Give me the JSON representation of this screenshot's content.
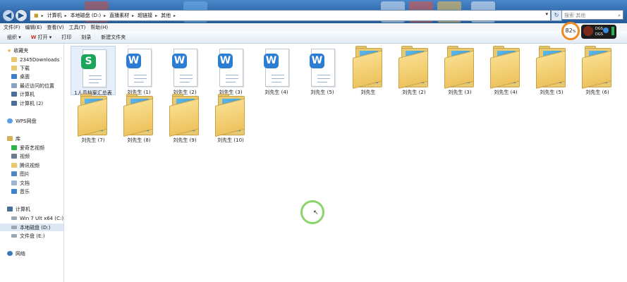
{
  "address": {
    "crumbs": [
      "计算机",
      "本地磁盘 (D:)",
      "直播素材",
      "超链接",
      "其他"
    ],
    "search_placeholder": "搜索 其他"
  },
  "menu": [
    "文件(F)",
    "编辑(E)",
    "查看(V)",
    "工具(T)",
    "帮助(H)"
  ],
  "toolbar": {
    "organize": "组织 ▾",
    "open": "打开 ▾",
    "print": "打印",
    "burn": "刻录",
    "new_folder": "新建文件夹"
  },
  "gauge": {
    "percent": "82",
    "unit": "%"
  },
  "widget": {
    "line1": "DGS",
    "line2": "DGS"
  },
  "nav": {
    "favorites": "收藏夹",
    "fav_items": [
      "2345Downloads",
      "下载",
      "桌面",
      "最近访问的位置",
      "计算机",
      "计算机 (2)"
    ],
    "wps": "WPS网盘",
    "library": "库",
    "lib_items": [
      "爱奇艺视频",
      "视频",
      "腾讯视频",
      "图片",
      "文档",
      "音乐"
    ],
    "computer": "计算机",
    "drives": [
      "Win 7 Ult x64 (C:)",
      "本地磁盘 (D:)",
      "文件盘 (E:)"
    ],
    "network": "网络"
  },
  "files": [
    {
      "name": "1人员档案汇总表",
      "type": "spreadsheet"
    },
    {
      "name": "刘先生 (1)",
      "type": "word"
    },
    {
      "name": "刘先生 (2)",
      "type": "word"
    },
    {
      "name": "刘先生 (3)",
      "type": "word"
    },
    {
      "name": "刘先生 (4)",
      "type": "word"
    },
    {
      "name": "刘先生 (5)",
      "type": "word"
    },
    {
      "name": "刘先生",
      "type": "folder"
    },
    {
      "name": "刘先生 (2)",
      "type": "folder"
    },
    {
      "name": "刘先生 (3)",
      "type": "folder"
    },
    {
      "name": "刘先生 (4)",
      "type": "folder"
    },
    {
      "name": "刘先生 (5)",
      "type": "folder"
    },
    {
      "name": "刘先生 (6)",
      "type": "folder"
    },
    {
      "name": "刘先生 (7)",
      "type": "folder"
    },
    {
      "name": "刘先生 (8)",
      "type": "folder"
    },
    {
      "name": "刘先生 (9)",
      "type": "folder"
    },
    {
      "name": "刘先生 (10)",
      "type": "folder"
    }
  ],
  "colors": {
    "word": "#2b7cd3",
    "spreadsheet": "#1aa55a",
    "accent": "#f08a1e"
  }
}
